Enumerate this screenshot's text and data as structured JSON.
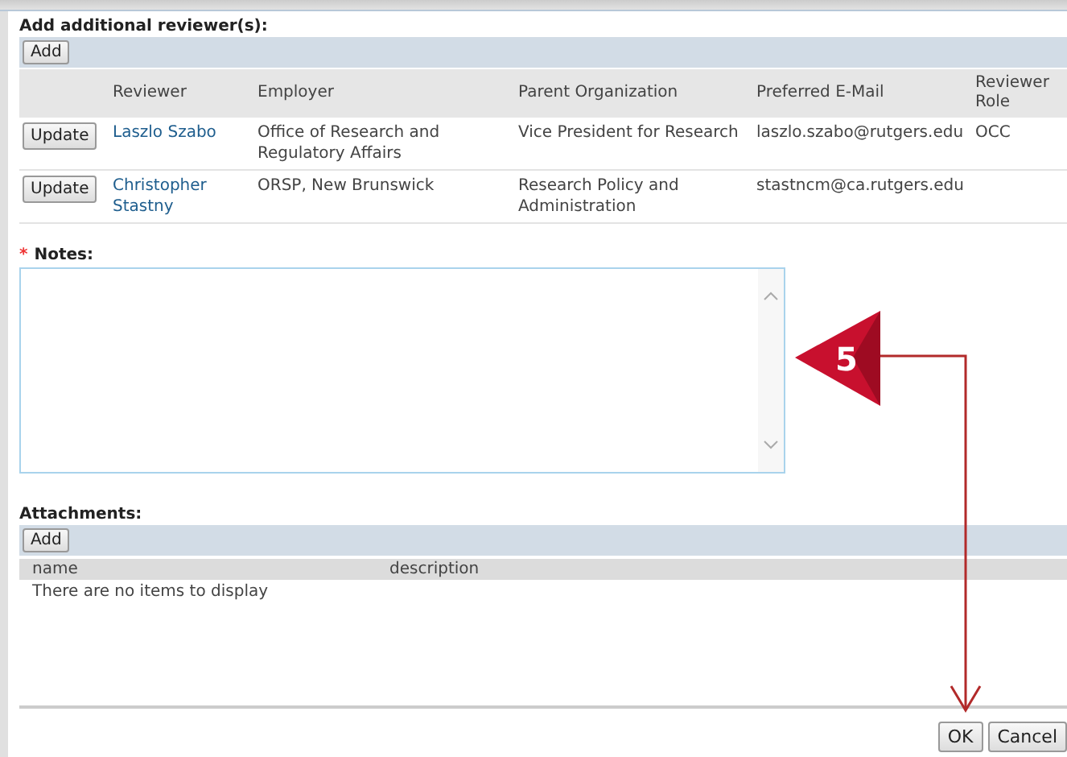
{
  "reviewers": {
    "label": "Add additional reviewer(s):",
    "add_button": "Add",
    "columns": [
      "Reviewer",
      "Employer",
      "Parent Organization",
      "Preferred E-Mail",
      "Reviewer Role"
    ],
    "rows": [
      {
        "button": "Update",
        "reviewer": "Laszlo Szabo",
        "employer": "Office of Research and Regulatory Affairs",
        "parent": "Vice President for Research",
        "email": "laszlo.szabo@rutgers.edu",
        "role": "OCC"
      },
      {
        "button": "Update",
        "reviewer": "Christopher Stastny",
        "employer": "ORSP, New Brunswick",
        "parent": "Research Policy and Administration",
        "email": "stastncm@ca.rutgers.edu",
        "role": ""
      }
    ]
  },
  "notes": {
    "required_mark": "*",
    "label": "Notes:",
    "required": true
  },
  "callout": {
    "number": "5"
  },
  "attachments": {
    "label": "Attachments:",
    "add_button": "Add",
    "columns": [
      "name",
      "description"
    ],
    "empty_message": "There are no items to display"
  },
  "buttons": [
    "OK",
    "Cancel"
  ]
}
